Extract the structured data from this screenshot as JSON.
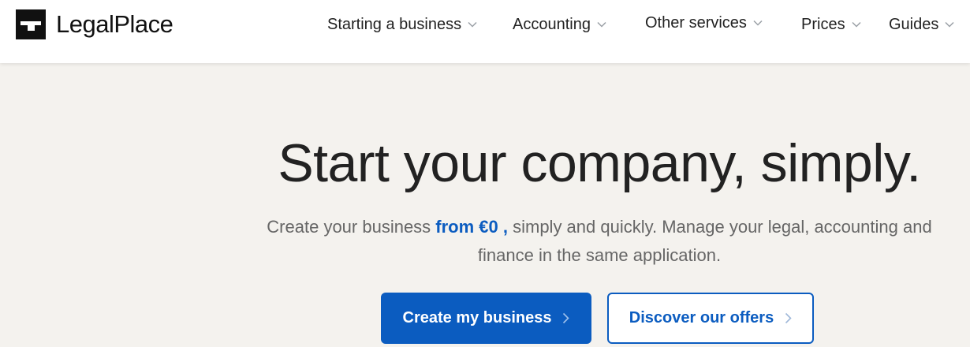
{
  "brand": {
    "name": "LegalPlace"
  },
  "nav": {
    "items": [
      {
        "label": "Starting a business"
      },
      {
        "label": "Accounting"
      },
      {
        "label": "Other services"
      },
      {
        "label": "Prices"
      },
      {
        "label": "Guides"
      }
    ]
  },
  "hero": {
    "headline": "Start your company, simply.",
    "subtitle_before": "Create your business ",
    "subtitle_highlight": "from €0 ,",
    "subtitle_after": " simply and quickly. Manage your legal, accounting and finance in the same application.",
    "primary_cta": "Create my business",
    "secondary_cta": "Discover our offers"
  },
  "colors": {
    "accent": "#0b5cc0",
    "background": "#f4f2ee",
    "header_bg": "#ffffff",
    "text": "#222222"
  },
  "icons": [
    "logo-icon",
    "chevron-down-icon",
    "chevron-right-icon"
  ]
}
